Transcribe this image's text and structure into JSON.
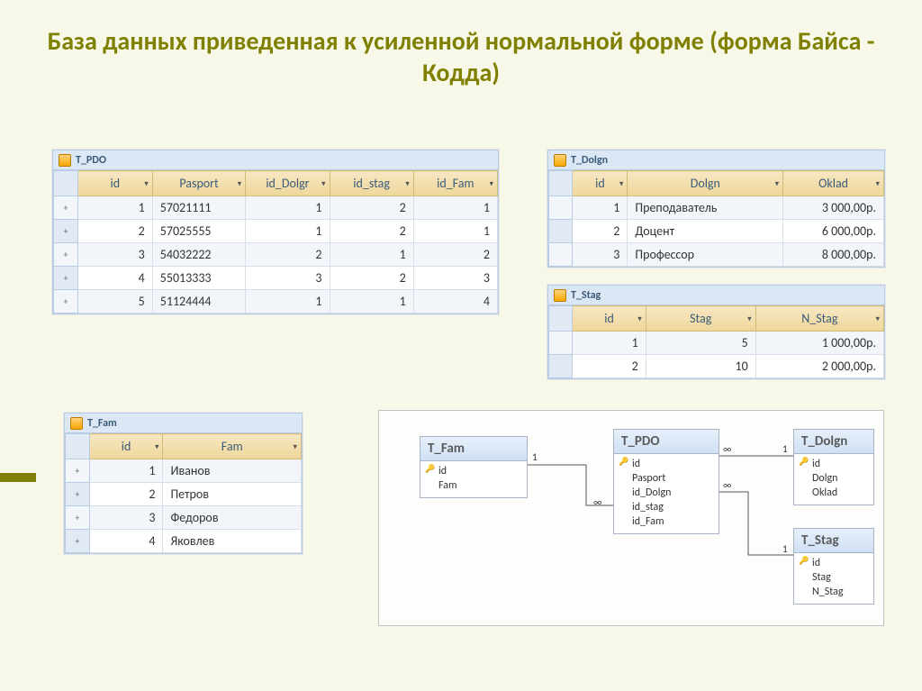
{
  "title": "База данных приведенная к усиленной нормальной форме  (форма Байса - Кодда)",
  "tbl_pdo": {
    "caption": "T_PDO",
    "cols": [
      "id",
      "Pasport",
      "id_Dolgr",
      "id_stag",
      "id_Fam"
    ],
    "rows": [
      [
        "1",
        "57021111",
        "1",
        "2",
        "1"
      ],
      [
        "2",
        "57025555",
        "1",
        "2",
        "1"
      ],
      [
        "3",
        "54032222",
        "2",
        "1",
        "2"
      ],
      [
        "4",
        "55013333",
        "3",
        "2",
        "3"
      ],
      [
        "5",
        "51124444",
        "1",
        "1",
        "4"
      ]
    ]
  },
  "tbl_dolgn": {
    "caption": "T_Dolgn",
    "cols": [
      "id",
      "Dolgn",
      "Oklad"
    ],
    "rows": [
      [
        "1",
        "Преподаватель",
        "3 000,00р."
      ],
      [
        "2",
        "Доцент",
        "6 000,00р."
      ],
      [
        "3",
        "Профессор",
        "8 000,00р."
      ]
    ]
  },
  "tbl_stag": {
    "caption": "T_Stag",
    "cols": [
      "id",
      "Stag",
      "N_Stag"
    ],
    "rows": [
      [
        "1",
        "5",
        "1 000,00р."
      ],
      [
        "2",
        "10",
        "2 000,00р."
      ]
    ]
  },
  "tbl_fam": {
    "caption": "T_Fam",
    "cols": [
      "id",
      "Fam"
    ],
    "rows": [
      [
        "1",
        "Иванов"
      ],
      [
        "2",
        "Петров"
      ],
      [
        "3",
        "Федоров"
      ],
      [
        "4",
        "Яковлев"
      ]
    ]
  },
  "diagram": {
    "entities": {
      "fam": {
        "title": "T_Fam",
        "fields": [
          "id",
          "Fam"
        ],
        "pk": 0
      },
      "pdo": {
        "title": "T_PDO",
        "fields": [
          "id",
          "Pasport",
          "id_Dolgn",
          "id_stag",
          "id_Fam"
        ],
        "pk": 0
      },
      "dolgn": {
        "title": "T_Dolgn",
        "fields": [
          "id",
          "Dolgn",
          "Oklad"
        ],
        "pk": 0
      },
      "stag": {
        "title": "T_Stag",
        "fields": [
          "id",
          "Stag",
          "N_Stag"
        ],
        "pk": 0
      }
    },
    "labels": {
      "one": "1",
      "many": "∞"
    }
  }
}
